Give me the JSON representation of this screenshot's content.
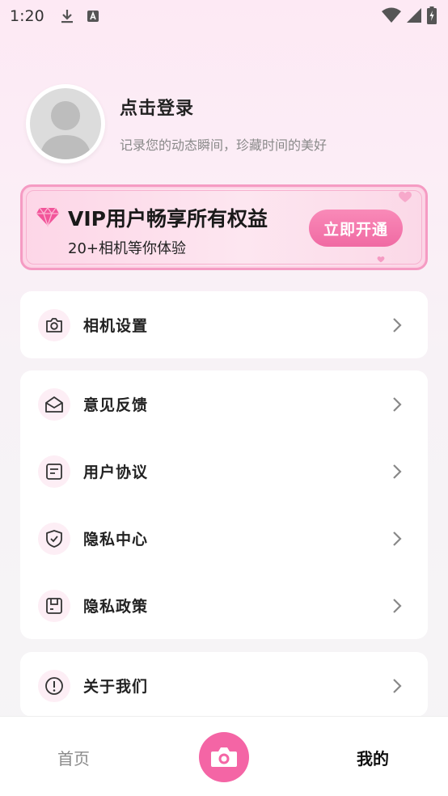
{
  "status_bar": {
    "time": "1:20"
  },
  "profile": {
    "title": "点击登录",
    "subtitle": "记录您的动态瞬间，珍藏时间的美好"
  },
  "vip": {
    "title": "VIP用户畅享所有权益",
    "subtitle": "20+相机等你体验",
    "button": "立即开通",
    "accent": "#f06aa3"
  },
  "groups": [
    [
      {
        "label": "相机设置",
        "icon": "camera-icon"
      }
    ],
    [
      {
        "label": "意见反馈",
        "icon": "envelope-open-icon"
      },
      {
        "label": "用户协议",
        "icon": "document-icon"
      },
      {
        "label": "隐私中心",
        "icon": "shield-check-icon"
      },
      {
        "label": "隐私政策",
        "icon": "policy-icon"
      }
    ],
    [
      {
        "label": "关于我们",
        "icon": "info-icon"
      }
    ]
  ],
  "tabs": {
    "home": "首页",
    "mine": "我的"
  }
}
